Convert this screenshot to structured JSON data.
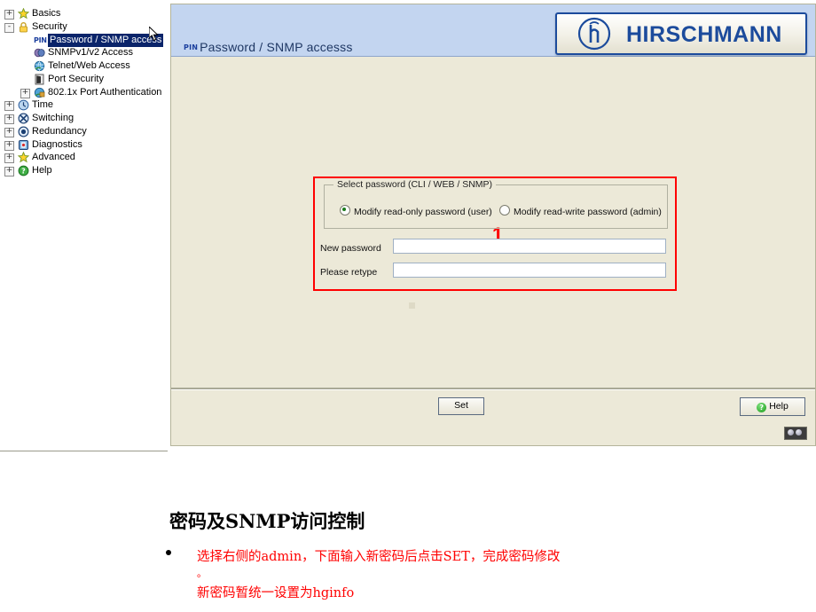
{
  "sidebar": {
    "name": "device-navigation-tree",
    "items": [
      {
        "label": "Basics",
        "icon": "star-icon",
        "indent": 0,
        "expander": "+",
        "selected": false
      },
      {
        "label": "Security",
        "icon": "padlock-icon",
        "indent": 0,
        "expander": "-",
        "selected": false
      },
      {
        "label": "Password / SNMP access",
        "icon": "pin-icon",
        "indent": 1,
        "expander": "",
        "selected": true
      },
      {
        "label": "SNMPv1/v2 Access",
        "icon": "masks-icon",
        "indent": 1,
        "expander": "",
        "selected": false
      },
      {
        "label": "Telnet/Web Access",
        "icon": "globe-icon",
        "indent": 1,
        "expander": "",
        "selected": false
      },
      {
        "label": "Port Security",
        "icon": "door-icon",
        "indent": 1,
        "expander": "",
        "selected": false
      },
      {
        "label": "802.1x Port Authentication",
        "icon": "shield-globe-icon",
        "indent": 1,
        "expander": "+",
        "selected": false
      },
      {
        "label": "Time",
        "icon": "clock-icon",
        "indent": 0,
        "expander": "+",
        "selected": false
      },
      {
        "label": "Switching",
        "icon": "switch-icon",
        "indent": 0,
        "expander": "+",
        "selected": false
      },
      {
        "label": "Redundancy",
        "icon": "ring-icon",
        "indent": 0,
        "expander": "+",
        "selected": false
      },
      {
        "label": "Diagnostics",
        "icon": "diagnostics-icon",
        "indent": 0,
        "expander": "+",
        "selected": false
      },
      {
        "label": "Advanced",
        "icon": "star-icon",
        "indent": 0,
        "expander": "+",
        "selected": false
      },
      {
        "label": "Help",
        "icon": "help-icon",
        "indent": 0,
        "expander": "+",
        "selected": false
      }
    ]
  },
  "header": {
    "title": "Password / SNMP accesss",
    "title_icon": "pin-icon",
    "brand": "HIRSCHMANN",
    "brand_mark": "h-in-circle-logo",
    "band_color": "#c3d5f0",
    "brand_color": "#1c4b9c"
  },
  "form": {
    "group_legend": "Select password  (CLI / WEB / SNMP)",
    "radios": [
      {
        "label": "Modify read-only password (user)",
        "selected": true
      },
      {
        "label": "Modify read-write password (admin)",
        "selected": false
      }
    ],
    "fields": [
      {
        "label": "New password",
        "value": "",
        "placeholder": ""
      },
      {
        "label": "Please retype",
        "value": "",
        "placeholder": ""
      }
    ],
    "annotation": {
      "marker": "1",
      "box_color": "#ff0000"
    }
  },
  "footer": {
    "set_label": "Set",
    "help_label": "Help",
    "help_icon": "question-icon",
    "status_indicator": "two-led-status-icon"
  },
  "notes": {
    "title": "密码及SNMP访问控制",
    "lines": [
      "选择右侧的admin，下面输入新密码后点击SET，完成密码修改",
      "。",
      "新密码暂统一设置为hginfo"
    ],
    "text_color": "#ff0000"
  }
}
